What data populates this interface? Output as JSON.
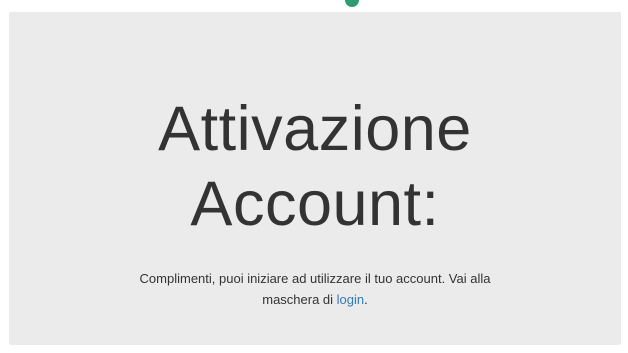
{
  "colors": {
    "panel_background": "#ebebeb",
    "text": "#333333",
    "link": "#337ab7",
    "top_mark": "#2e9c72"
  },
  "activation": {
    "title_line1": "Attivazione",
    "title_line2": "Account:",
    "message_line1": "Complimenti, puoi iniziare ad utilizzare il tuo account. Vai alla",
    "message_line2_prefix": "maschera di ",
    "login_link": "login",
    "message_line2_suffix": "."
  }
}
